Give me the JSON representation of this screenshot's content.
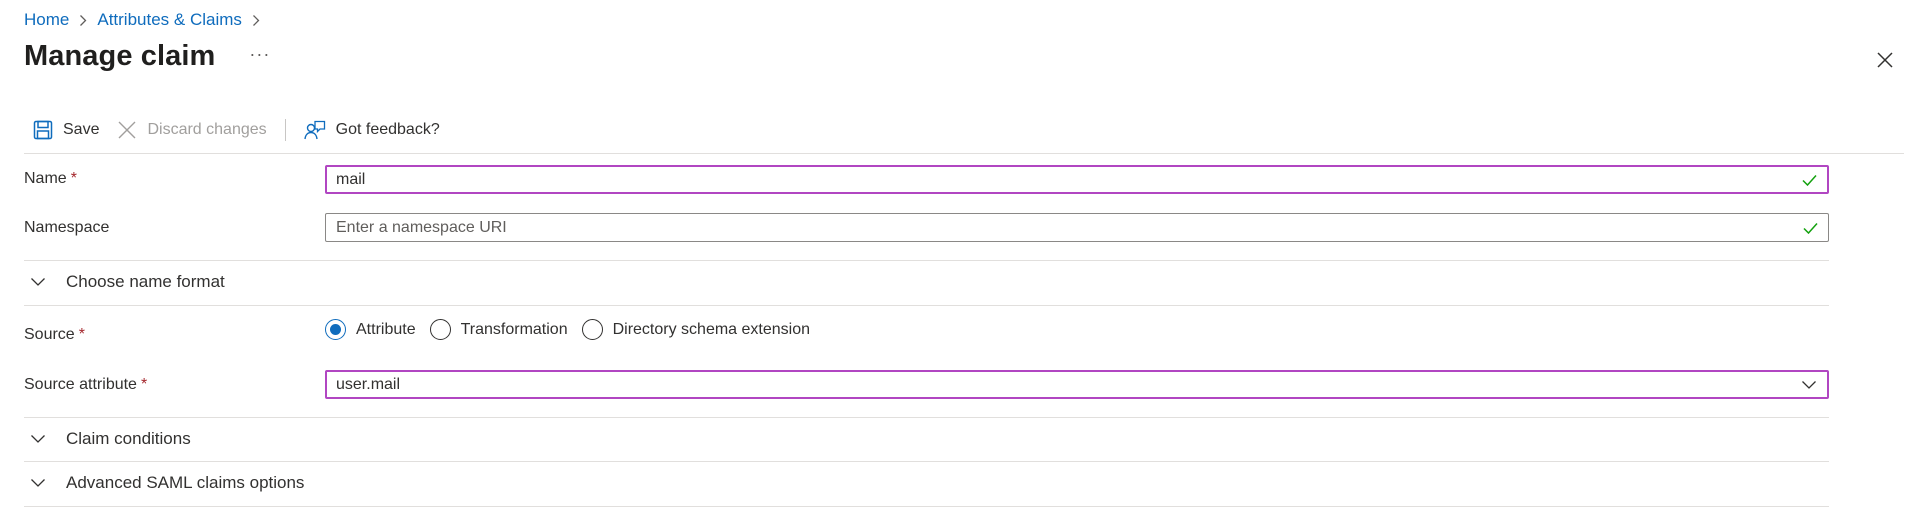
{
  "breadcrumb": {
    "items": [
      "Home",
      "Attributes & Claims"
    ]
  },
  "header": {
    "title": "Manage claim",
    "more_label": "···"
  },
  "toolbar": {
    "save_label": "Save",
    "discard_label": "Discard changes",
    "feedback_label": "Got feedback?"
  },
  "form": {
    "name": {
      "label": "Name",
      "required_mark": "*",
      "value": "mail"
    },
    "namespace": {
      "label": "Namespace",
      "placeholder": "Enter a namespace URI",
      "value": ""
    },
    "name_format": {
      "label": "Choose name format"
    },
    "source": {
      "label": "Source",
      "required_mark": "*",
      "options": [
        "Attribute",
        "Transformation",
        "Directory schema extension"
      ],
      "selected": "Attribute"
    },
    "source_attribute": {
      "label": "Source attribute",
      "required_mark": "*",
      "value": "user.mail"
    },
    "claim_conditions": {
      "label": "Claim conditions"
    },
    "advanced_saml": {
      "label": "Advanced SAML claims options"
    }
  },
  "colors": {
    "link": "#0f6cbd",
    "required": "#a4262c",
    "focus_border": "#b146c2",
    "valid_check": "#13a10e",
    "radio_accent": "#0f6cbd"
  }
}
